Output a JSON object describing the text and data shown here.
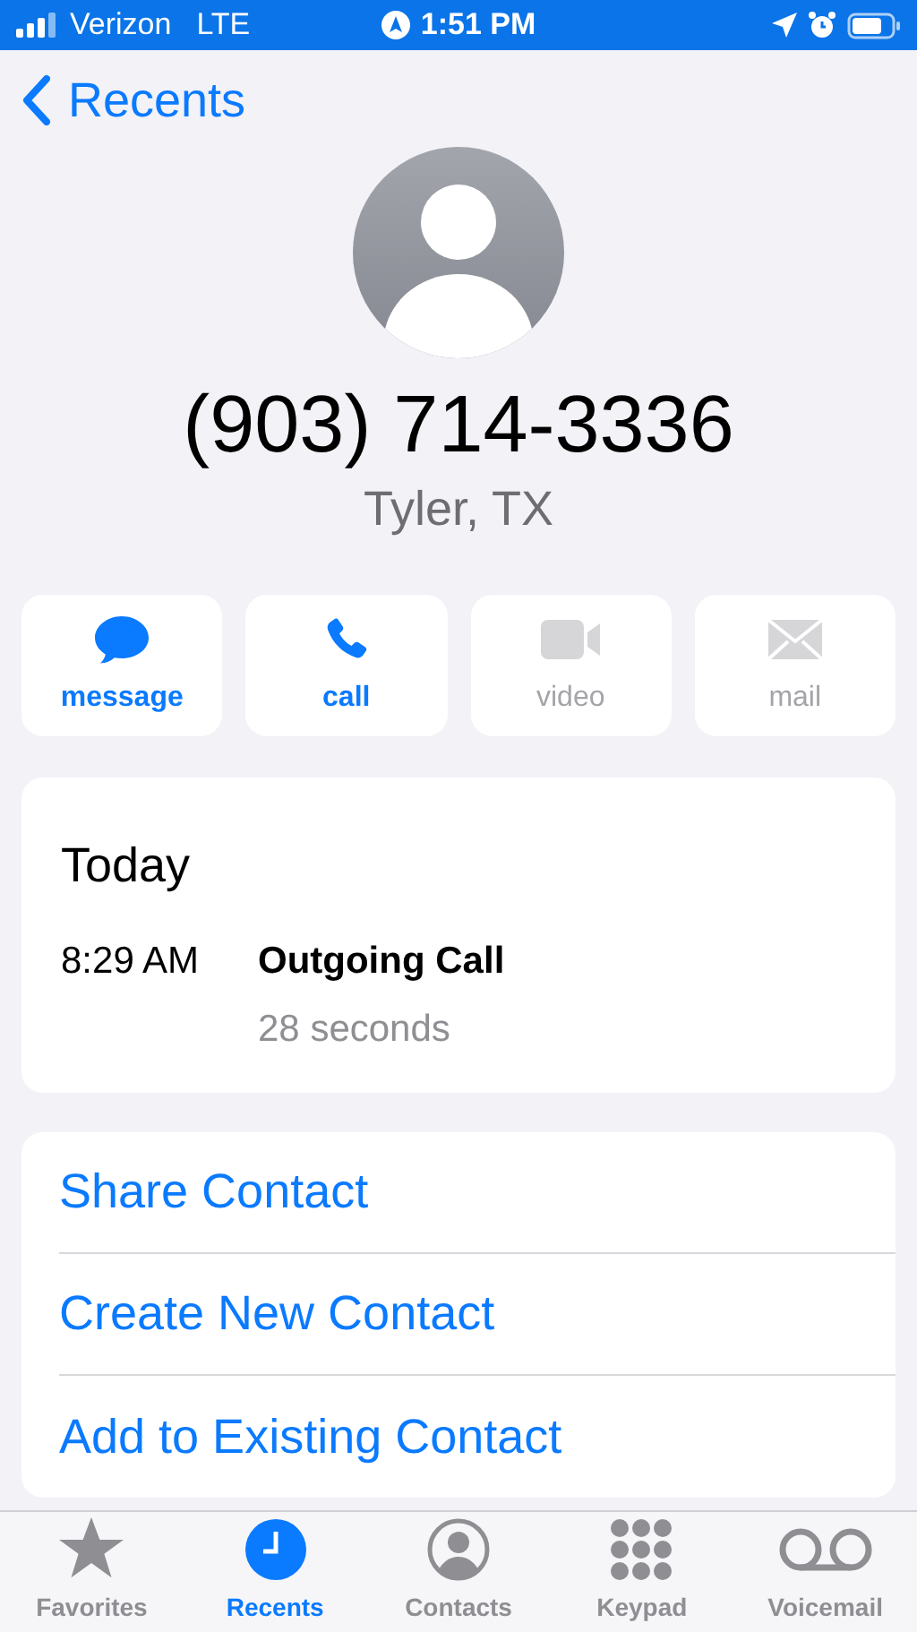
{
  "status_bar": {
    "carrier": "Verizon",
    "network": "LTE",
    "time": "1:51 PM"
  },
  "nav": {
    "back_label": "Recents"
  },
  "contact": {
    "number": "(903) 714-3336",
    "location": "Tyler, TX"
  },
  "actions": [
    {
      "kind": "message",
      "label": "message",
      "disabled": false
    },
    {
      "kind": "call",
      "label": "call",
      "disabled": false
    },
    {
      "kind": "video",
      "label": "video",
      "disabled": true
    },
    {
      "kind": "mail",
      "label": "mail",
      "disabled": true
    }
  ],
  "history": {
    "heading": "Today",
    "entries": [
      {
        "time": "8:29 AM",
        "type": "Outgoing Call",
        "duration": "28 seconds"
      }
    ]
  },
  "options": [
    "Share Contact",
    "Create New Contact",
    "Add to Existing Contact"
  ],
  "tabs": [
    {
      "kind": "favorites",
      "label": "Favorites",
      "selected": false
    },
    {
      "kind": "recents",
      "label": "Recents",
      "selected": true
    },
    {
      "kind": "contacts",
      "label": "Contacts",
      "selected": false
    },
    {
      "kind": "keypad",
      "label": "Keypad",
      "selected": false
    },
    {
      "kind": "voicemail",
      "label": "Voicemail",
      "selected": false
    }
  ]
}
